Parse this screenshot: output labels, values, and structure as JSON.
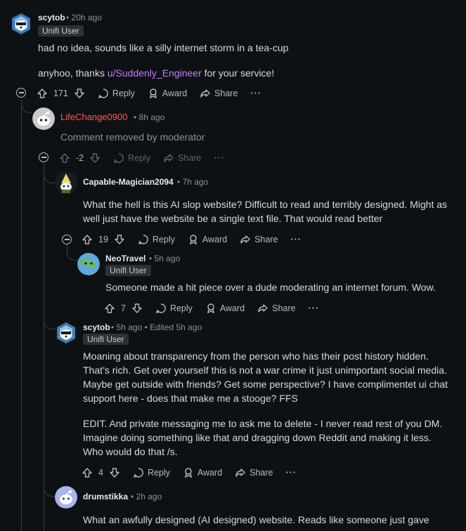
{
  "comments": [
    {
      "username": "scytob",
      "time": "20h ago",
      "flair": "Unifi User",
      "body_line1": "had no idea, sounds like a silly internet storm in a tea-cup",
      "body_line2_pre": "anyhoo, thanks ",
      "body_line2_link": "u/Suddenly_Engineer",
      "body_line2_post": " for your service!",
      "score": "171",
      "reply_label": "Reply",
      "award_label": "Award",
      "share_label": "Share"
    },
    {
      "username": "LifeChange0900",
      "time": "8h ago",
      "body": "Comment removed by moderator",
      "score": "-2",
      "reply_label": "Reply",
      "share_label": "Share"
    },
    {
      "username": "Capable-Magician2094",
      "time": "7h ago",
      "body": "What the hell is this AI slop website? Difficult to read and terribly designed. Might as well just have the website be a single text file. That would read better",
      "score": "19",
      "reply_label": "Reply",
      "award_label": "Award",
      "share_label": "Share"
    },
    {
      "username": "NeoTravel",
      "time": "5h ago",
      "flair": "Unifi User",
      "body": "Someone made a hit piece over a dude moderating an internet forum. Wow.",
      "score": "7",
      "reply_label": "Reply",
      "award_label": "Award",
      "share_label": "Share"
    },
    {
      "username": "scytob",
      "time": "5h ago",
      "edited": "Edited 5h ago",
      "flair": "Unifi User",
      "body_p1": "Moaning about transparency from the person who has their post history hidden. That’s rich. Get over yourself this is not a war crime it just unimportant social media. Maybe get outside with friends? Get some perspective? I have complimentet ui chat support here - does that make me a stooge? FFS",
      "body_p2": "EDIT. And private messaging me to ask me to delete - I never read rest of you DM. Imagine doing something like that and dragging down Reddit and making it less. Who would do that /s.",
      "score": "4",
      "reply_label": "Reply",
      "award_label": "Award",
      "share_label": "Share"
    },
    {
      "username": "drumstikka",
      "time": "2h ago",
      "body": "What an awfully designed (AI designed) website. Reads like someone just gave"
    }
  ],
  "separator": "•",
  "more_label": "···",
  "colors": {
    "background": "#0e1113",
    "text": "#d7dadc",
    "meta": "#8a9195",
    "link": "#c87bff",
    "removed_user": "#ff585b",
    "flair_bg": "#2a3236"
  }
}
